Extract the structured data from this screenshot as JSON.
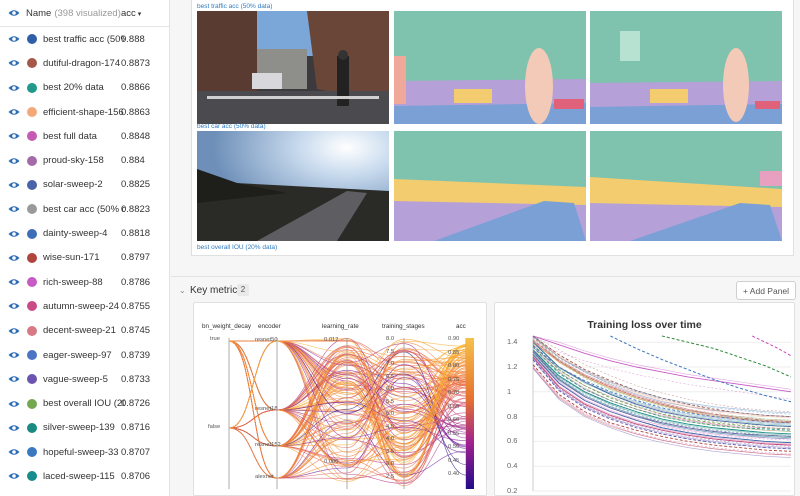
{
  "sidebar": {
    "header": {
      "name_label": "Name",
      "count_label": "(398 visualized)",
      "sort_label": "acc",
      "sort_caret": "▾"
    },
    "rows": [
      {
        "name": "best traffic acc (50%",
        "acc": "0.888",
        "color": "#2f5fa6"
      },
      {
        "name": "dutiful-dragon-174",
        "acc": "0.8873",
        "color": "#a5584a"
      },
      {
        "name": "best 20% data",
        "acc": "0.8866",
        "color": "#1f9a8a"
      },
      {
        "name": "efficient-shape-156",
        "acc": "0.8863",
        "color": "#f2a97a"
      },
      {
        "name": "best full data",
        "acc": "0.8848",
        "color": "#c45ab3"
      },
      {
        "name": "proud-sky-158",
        "acc": "0.884",
        "color": "#a56aa8"
      },
      {
        "name": "solar-sweep-2",
        "acc": "0.8825",
        "color": "#4a63a8"
      },
      {
        "name": "best car acc (50% da",
        "acc": "0.8823",
        "color": "#9a9a9a"
      },
      {
        "name": "dainty-sweep-4",
        "acc": "0.8818",
        "color": "#3c6fb6"
      },
      {
        "name": "wise-sun-171",
        "acc": "0.8797",
        "color": "#b0453e"
      },
      {
        "name": "rich-sweep-88",
        "acc": "0.8786",
        "color": "#c75bc4"
      },
      {
        "name": "autumn-sweep-24",
        "acc": "0.8755",
        "color": "#c94a86"
      },
      {
        "name": "decent-sweep-21",
        "acc": "0.8745",
        "color": "#d77a86"
      },
      {
        "name": "eager-sweep-97",
        "acc": "0.8739",
        "color": "#4a74c4"
      },
      {
        "name": "vague-sweep-5",
        "acc": "0.8733",
        "color": "#6b55b0"
      },
      {
        "name": "best overall IOU (20(",
        "acc": "0.8726",
        "color": "#74a850"
      },
      {
        "name": "silver-sweep-139",
        "acc": "0.8716",
        "color": "#188a82"
      },
      {
        "name": "hopeful-sweep-33",
        "acc": "0.8707",
        "color": "#3a78c0"
      },
      {
        "name": "laced-sweep-115",
        "acc": "0.8706",
        "color": "#178c8c"
      }
    ]
  },
  "media": {
    "captions": [
      "best traffic acc (50% data)",
      "best car acc (50% data)",
      "best overall IOU (20% data)"
    ]
  },
  "key_metrics": {
    "title": "Key metrics",
    "count": "2",
    "add_panel_label": "+ Add Panel",
    "parcoords": {
      "axes": [
        "bn_weight_decay",
        "encoder",
        "learning_rate",
        "training_stages",
        "acc"
      ],
      "bn_ticks": [
        "true",
        "false"
      ],
      "encoder_ticks": [
        "resnet50",
        "resnet18",
        "resnet152",
        "alexnet"
      ],
      "lr_ticks": [
        "0.012",
        "0.000"
      ],
      "ts_ticks": [
        "8.0",
        "7.5",
        "7.0",
        "6.5",
        "6.0",
        "5.5",
        "5.0",
        "4.5",
        "4.0",
        "3.5",
        "3.0",
        "2.5"
      ],
      "acc_ticks": [
        "0.90",
        "0.85",
        "0.80",
        "0.75",
        "0.70",
        "0.65",
        "0.60",
        "0.55",
        "0.50",
        "0.45",
        "0.40"
      ]
    },
    "loss_chart": {
      "title": "Training loss over time",
      "yticks": [
        "1.4",
        "1.2",
        "1",
        "0.8",
        "0.6",
        "0.4",
        "0.2"
      ]
    }
  },
  "chart_data": {
    "type": "line",
    "title": "Training loss over time",
    "ylim": [
      0.2,
      1.45
    ],
    "x": [
      0,
      1,
      2,
      3,
      4,
      5,
      6,
      7,
      8,
      9,
      10
    ],
    "series": [
      {
        "values": [
          1.4,
          1.2,
          1.08,
          0.98,
          0.9,
          0.84,
          0.8,
          0.77,
          0.75,
          0.73,
          0.72
        ],
        "color": "#4a63a8"
      },
      {
        "values": [
          1.36,
          1.15,
          1.02,
          0.93,
          0.86,
          0.8,
          0.76,
          0.73,
          0.71,
          0.7,
          0.69
        ],
        "color": "#1f9a8a"
      },
      {
        "values": [
          1.32,
          1.1,
          0.96,
          0.87,
          0.8,
          0.75,
          0.71,
          0.68,
          0.66,
          0.65,
          0.64
        ],
        "color": "#c45ab3"
      },
      {
        "values": [
          1.42,
          1.25,
          1.13,
          1.04,
          0.96,
          0.9,
          0.85,
          0.82,
          0.79,
          0.77,
          0.76
        ],
        "color": "#d77a86"
      },
      {
        "values": [
          1.3,
          1.07,
          0.93,
          0.84,
          0.77,
          0.71,
          0.67,
          0.64,
          0.62,
          0.6,
          0.59
        ],
        "color": "#2f5fa6"
      },
      {
        "values": [
          1.38,
          1.18,
          1.05,
          0.95,
          0.88,
          0.82,
          0.78,
          0.75,
          0.73,
          0.71,
          0.7
        ],
        "color": "#74a850"
      },
      {
        "values": [
          1.28,
          1.04,
          0.9,
          0.81,
          0.74,
          0.69,
          0.65,
          0.62,
          0.6,
          0.58,
          0.57
        ],
        "color": "#c94a86"
      },
      {
        "values": [
          1.45,
          1.3,
          1.18,
          1.09,
          1.01,
          0.95,
          0.9,
          0.86,
          0.83,
          0.81,
          0.8
        ],
        "color": "#a5584a"
      },
      {
        "values": [
          1.34,
          1.13,
          1.0,
          0.91,
          0.84,
          0.78,
          0.74,
          0.71,
          0.69,
          0.67,
          0.66
        ],
        "color": "#188a82"
      },
      {
        "values": [
          1.26,
          1.01,
          0.87,
          0.78,
          0.71,
          0.66,
          0.62,
          0.59,
          0.57,
          0.55,
          0.54
        ],
        "color": "#6b55b0"
      },
      {
        "values": [
          1.4,
          1.24,
          1.12,
          1.03,
          0.95,
          0.89,
          0.84,
          0.8,
          0.78,
          0.76,
          0.75
        ],
        "color": "#f2a97a"
      },
      {
        "values": [
          1.37,
          1.2,
          1.09,
          1.0,
          0.93,
          0.87,
          0.83,
          0.8,
          0.78,
          0.76,
          0.75
        ],
        "color": "#3a78c0"
      },
      {
        "values": [
          1.45,
          1.38,
          1.31,
          1.25,
          1.2,
          1.16,
          1.12,
          1.09,
          1.06,
          1.03,
          1.0
        ],
        "color": "#c75bc4"
      },
      {
        "values": [
          1.22,
          0.98,
          0.84,
          0.75,
          0.69,
          0.64,
          0.6,
          0.57,
          0.55,
          0.53,
          0.52
        ],
        "color": "#b0453e"
      }
    ],
    "extra_series": [
      {
        "x": [
          5,
          6,
          7,
          8,
          9,
          10
        ],
        "values": [
          1.45,
          1.4,
          1.35,
          1.28,
          1.21,
          1.12
        ],
        "color": "#2e8b3a"
      },
      {
        "x": [
          8.5,
          9,
          9.5,
          10
        ],
        "values": [
          1.45,
          1.4,
          1.35,
          1.29
        ],
        "color": "#c94ab8"
      },
      {
        "x": [
          3,
          4,
          5,
          6,
          7,
          8,
          9,
          10
        ],
        "values": [
          1.45,
          1.35,
          1.26,
          1.18,
          1.1,
          1.03,
          0.97,
          0.92
        ],
        "color": "#3a78c0"
      }
    ]
  }
}
